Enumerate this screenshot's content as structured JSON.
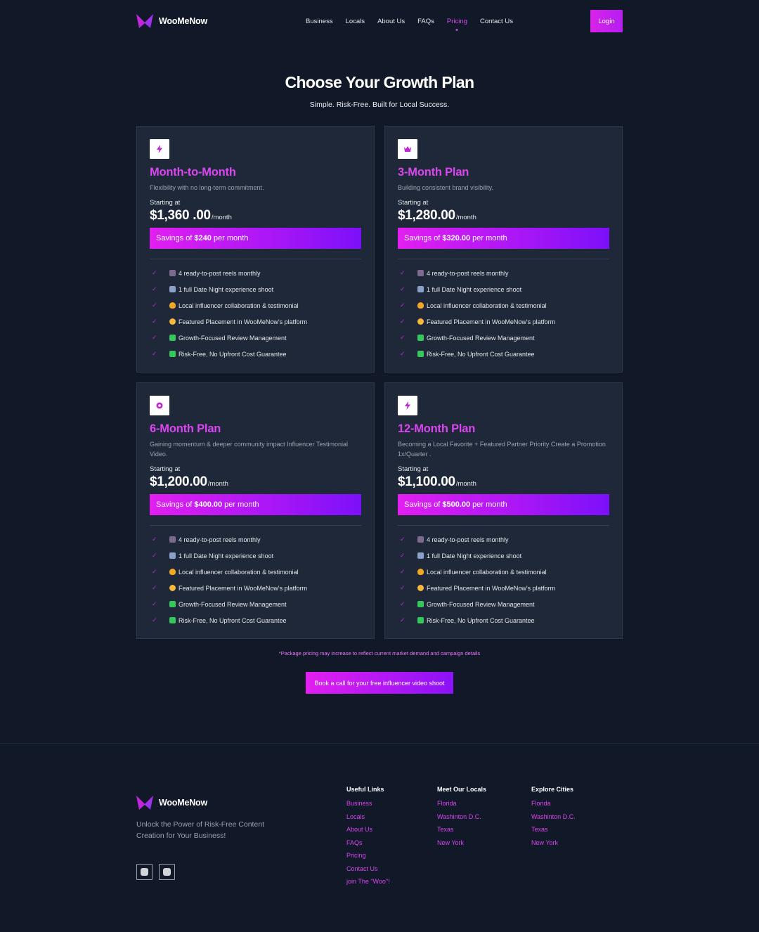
{
  "brand": {
    "name": "WooMeNow"
  },
  "nav": {
    "items": [
      {
        "label": "Business",
        "active": false
      },
      {
        "label": "Locals",
        "active": false
      },
      {
        "label": "About Us",
        "active": false
      },
      {
        "label": "FAQs",
        "active": false
      },
      {
        "label": "Pricing",
        "active": true
      },
      {
        "label": "Contact Us",
        "active": false
      }
    ],
    "login_label": "Login"
  },
  "hero": {
    "title": "Choose Your Growth Plan",
    "subtitle": "Simple. Risk-Free. Built for Local Success."
  },
  "plans": [
    {
      "icon": "lightning-icon",
      "name": "Month-to-Month",
      "desc": "Flexibility with no long-term commitment.",
      "starting": "Starting at",
      "price": "$1,360 .00",
      "per": "/month",
      "savings_prefix": "Savings of",
      "savings_amount": "$240",
      "savings_suffix": "per month"
    },
    {
      "icon": "crown-icon",
      "name": "3-Month Plan",
      "desc": "Building consistent brand visibility.",
      "starting": "Starting at",
      "price": "$1,280.00",
      "per": "/month",
      "savings_prefix": "Savings of",
      "savings_amount": "$320.00",
      "savings_suffix": "per month"
    },
    {
      "icon": "gear-icon",
      "name": "6-Month Plan",
      "desc": "Gaining momentum & deeper community impact Influencer Testimonial Video.",
      "starting": "Starting at",
      "price": "$1,200.00",
      "per": "/month",
      "savings_prefix": "Savings of",
      "savings_amount": "$400.00",
      "savings_suffix": "per month"
    },
    {
      "icon": "lightning-icon",
      "name": "12-Month Plan",
      "desc": "Becoming a Local Favorite + Featured Partner Priority Create a Promotion 1x/Quarter .",
      "starting": "Starting at",
      "price": "$1,100.00",
      "per": "/month",
      "savings_prefix": "Savings of",
      "savings_amount": "$500.00",
      "savings_suffix": "per month"
    }
  ],
  "features": [
    {
      "emoji": "camera-icon",
      "text": "4 ready-to-post reels monthly"
    },
    {
      "emoji": "calendar-icon",
      "text": "1 full Date Night experience shoot"
    },
    {
      "emoji": "heart-icon",
      "text": "Local influencer collaboration & testimonial"
    },
    {
      "emoji": "star-icon",
      "text": "Featured Placement in WooMeNow's platform"
    },
    {
      "emoji": "checkbox-icon",
      "text": "Growth-Focused Review Management"
    },
    {
      "emoji": "checkbox-icon",
      "text": "Risk-Free, No Upfront Cost Guarantee"
    }
  ],
  "disclaimer": "*Package pricing may increase to reflect current market demand and campaign details",
  "cta_label": "Book a call for your free influencer video shoot",
  "footer": {
    "tagline": "Unlock the Power of Risk-Free Content Creation for Your Business!",
    "columns": [
      {
        "title": "Useful Links",
        "links": [
          "Business",
          "Locals",
          "About Us",
          "FAQs",
          "Pricing",
          "Contact Us",
          "join The \"Woo\"!"
        ]
      },
      {
        "title": "Meet Our Locals",
        "links": [
          "Florida",
          "Washinton D.C.",
          "Texas",
          "New York"
        ]
      },
      {
        "title": "Explore Cities",
        "links": [
          "Florida",
          "Washinton D.C.",
          "Texas",
          "New York"
        ]
      }
    ],
    "socials": [
      "instagram-icon",
      "facebook-icon"
    ]
  },
  "colors": {
    "background": "#111827",
    "card": "#1f2838",
    "accent": "#d946ef",
    "accent_purple": "#7c10f8"
  }
}
